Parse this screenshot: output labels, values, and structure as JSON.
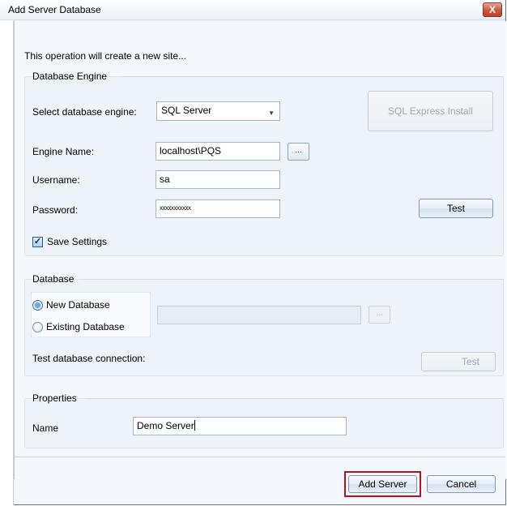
{
  "window": {
    "title": "Add Server Database",
    "close_glyph": "X"
  },
  "intro_text": "This operation will create a new site...",
  "engine_group": {
    "legend": "Database Engine",
    "select_engine_label": "Select database engine:",
    "select_engine_value": "SQL Server",
    "sql_express_button": "SQL Express Install",
    "engine_name_label": "Engine Name:",
    "engine_name_value": "localhost\\PQS",
    "browse_glyph": "...",
    "username_label": "Username:",
    "username_value": "sa",
    "password_label": "Password:",
    "password_value": "xxxxxxxxxxx",
    "test_button": "Test",
    "save_settings_label": "Save Settings",
    "save_settings_checked": true
  },
  "database_group": {
    "legend": "Database",
    "new_database_label": "New Database",
    "existing_database_label": "Existing Database",
    "selected_option": "New Database",
    "database_name_value": "",
    "browse_glyph": "...",
    "test_connection_label": "Test database connection:",
    "test_button": "Test"
  },
  "properties_group": {
    "legend": "Properties",
    "name_label": "Name",
    "name_value": "Demo Server"
  },
  "footer": {
    "add_server_button": "Add Server",
    "cancel_button": "Cancel"
  }
}
